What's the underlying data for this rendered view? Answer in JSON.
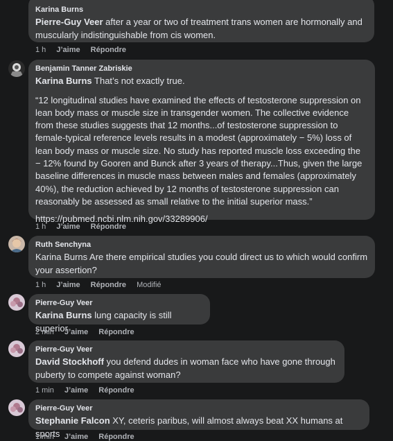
{
  "comments": [
    {
      "author": "Karina Burns",
      "mention": "Pierre-Guy Veer",
      "text": " after a year or two of treatment trans women are hormonally and muscularly indistinguishable from cis women.",
      "time": "1 h",
      "like": "J’aime",
      "reply": "Répondre"
    },
    {
      "author": "Benjamin Tanner Zabriskie",
      "mention": "Karina Burns",
      "text": " That’s not exactly true.",
      "quote": "“12 longitudinal studies have examined the effects of testosterone suppression on lean body mass or muscle size in transgender women. The collective evidence from these studies suggests that 12 months...of testosterone suppression to female-typical reference levels results in a modest (approximately − 5%) loss of lean body mass or muscle size. No study has reported muscle loss exceeding the − 12% found by Gooren and Bunck after 3 years of therapy...Thus, given the large baseline differences in muscle mass between males and females (approximately 40%), the reduction achieved by 12 months of testosterone suppression can reasonably be assessed as small relative to the initial superior mass.”",
      "link": "https://pubmed.ncbi.nlm.nih.gov/33289906/",
      "time": "1 h",
      "like": "J’aime",
      "reply": "Répondre"
    },
    {
      "author": "Ruth Senchyna",
      "text": "Karina Burns Are there empirical studies you could direct us to which would confirm your assertion?",
      "time": "1 h",
      "like": "J’aime",
      "reply": "Répondre",
      "edited": "Modifié"
    },
    {
      "author": "Pierre-Guy Veer",
      "mention": "Karina Burns",
      "text": " lung capacity is still superior",
      "time": "2 min",
      "like": "J’aime",
      "reply": "Répondre"
    },
    {
      "author": "Pierre-Guy Veer",
      "mention": "David Stockhoff",
      "text": " you defend dudes in woman face who have gone through puberty to compete against woman?",
      "time": "1 min",
      "like": "J’aime",
      "reply": "Répondre"
    },
    {
      "author": "Pierre-Guy Veer",
      "mention": "Stephanie Falcon",
      "text": " XY, ceteris paribus, will almost always beat XX humans at sports",
      "time": "1 min",
      "like": "J’aime",
      "reply": "Répondre"
    }
  ],
  "colors": {
    "background": "#18191a",
    "bubble": "#3a3b3c",
    "text": "#e4e6eb",
    "meta": "#b0b3b8"
  }
}
